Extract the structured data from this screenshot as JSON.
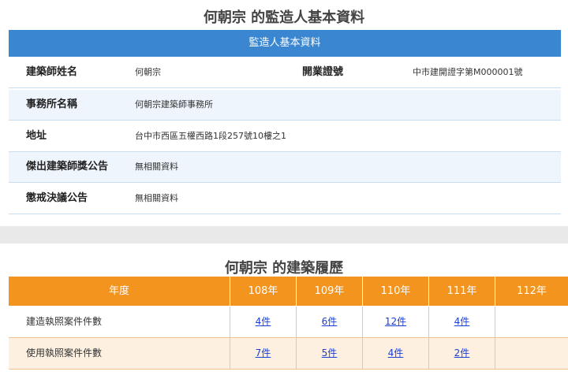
{
  "supervisor": {
    "page_title": "何朝宗 的監造人基本資料",
    "section_header": "監造人基本資料",
    "rows": [
      {
        "label": "建築師姓名",
        "value": "何朝宗",
        "label2": "開業證號",
        "value2": "中市建開證字第M000001號"
      },
      {
        "label": "事務所名稱",
        "value": "何朝宗建築師事務所"
      },
      {
        "label": "地址",
        "value": "台中市西區五權西路1段257號10樓之1"
      },
      {
        "label": "傑出建築師獎公告",
        "value": "無相關資料"
      },
      {
        "label": "懲戒決議公告",
        "value": "無相關資料"
      }
    ]
  },
  "history": {
    "page_title": "何朝宗 的建築履歷",
    "year_header": "年度",
    "years": [
      "108年",
      "109年",
      "110年",
      "111年",
      "112年"
    ],
    "rows": [
      {
        "label": "建造執照案件件數",
        "values": [
          "4件",
          "6件",
          "12件",
          "4件",
          ""
        ]
      },
      {
        "label": "使用執照案件件數",
        "values": [
          "7件",
          "5件",
          "4件",
          "2件",
          ""
        ]
      }
    ]
  },
  "colors": {
    "blue_header": "#3a86d0",
    "orange_header": "#f3941f",
    "link": "#1a3fd1"
  }
}
